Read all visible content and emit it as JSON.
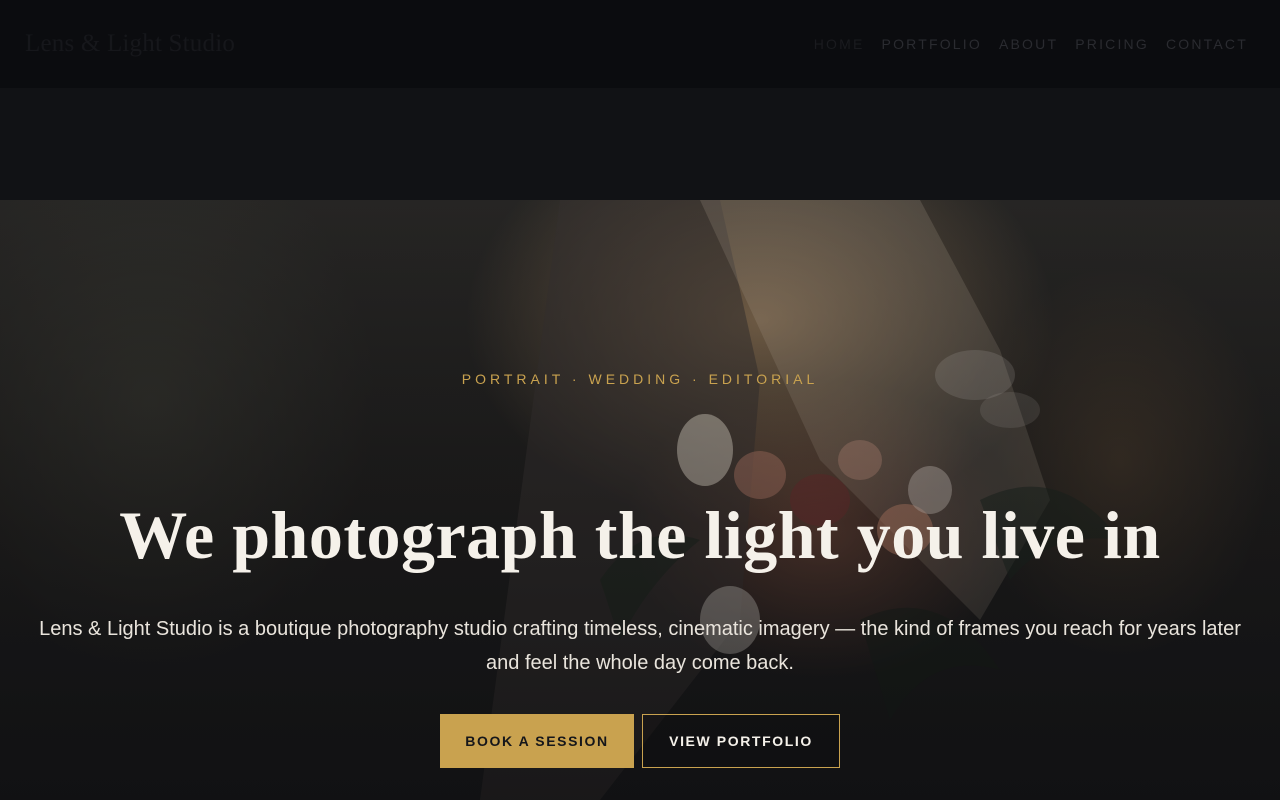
{
  "header": {
    "logo": "Lens & Light Studio",
    "nav": [
      {
        "label": "HOME",
        "active": true
      },
      {
        "label": "PORTFOLIO"
      },
      {
        "label": "ABOUT"
      },
      {
        "label": "PRICING"
      },
      {
        "label": "CONTACT"
      }
    ]
  },
  "hero": {
    "eyebrow": "PORTRAIT · WEDDING · EDITORIAL",
    "headline": "We photograph the light you live in",
    "subtext": "Lens & Light Studio is a boutique photography studio crafting timeless, cinematic imagery — the kind of frames you reach for years later and feel the whole day come back.",
    "primary_cta": "BOOK A SESSION",
    "secondary_cta": "VIEW PORTFOLIO"
  },
  "colors": {
    "accent": "#c9a24f",
    "header_bg": "#0b0c0f",
    "headline": "#f5f1ea"
  }
}
